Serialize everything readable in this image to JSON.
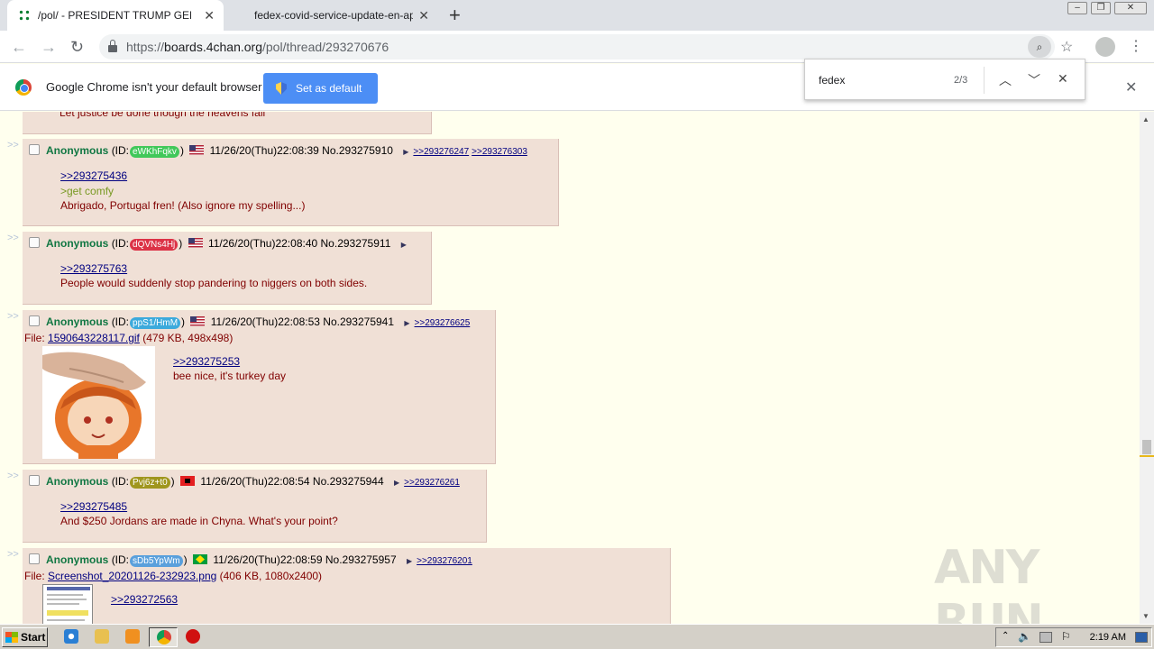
{
  "browser": {
    "tabs": [
      {
        "title": "/pol/ - PRESIDENT TRUMP GENERAL",
        "active": true
      },
      {
        "title": "fedex-covid-service-update-en-apac",
        "active": false
      }
    ],
    "url_scheme": "https://",
    "url_host": "boards.4chan.org",
    "url_path": "/pol/thread/293270676"
  },
  "infobar": {
    "message": "Google Chrome isn't your default browser",
    "button_label": "Set as default"
  },
  "find": {
    "query": "fedex",
    "count": "2/3"
  },
  "partial_post": {
    "text": "Let justice be done though the heavens fall"
  },
  "posts": [
    {
      "name": "Anonymous",
      "id_prefix": "(ID:",
      "id": "eWKhFqkv",
      "id_color": "#41c85a",
      "id_suffix": ")",
      "flag": "us",
      "datetime": "11/26/20(Thu)22:08:39",
      "number": "No.293275910",
      "backlinks": [
        ">>293276247",
        ">>293276303"
      ],
      "quote": ">>293275436",
      "greentext": ">get comfy",
      "text": "Abrigado, Portugal fren! (Also ignore my spelling...)"
    },
    {
      "name": "Anonymous",
      "id_prefix": "(ID:",
      "id": "dQVNs4Hj",
      "id_color": "#dc3246",
      "id_suffix": ")",
      "flag": "us",
      "datetime": "11/26/20(Thu)22:08:40",
      "number": "No.293275911",
      "backlinks": [],
      "quote": ">>293275763",
      "text": "People would suddenly stop pandering to niggers on both sides."
    },
    {
      "name": "Anonymous",
      "id_prefix": "(ID:",
      "id": "ppS1/HmM",
      "id_color": "#3caadc",
      "id_suffix": ")",
      "flag": "us",
      "datetime": "11/26/20(Thu)22:08:53",
      "number": "No.293275941",
      "backlinks": [
        ">>293276625"
      ],
      "file_label": "File:",
      "file_name": "1590643228117.gif",
      "file_info": "(479 KB, 498x498)",
      "quote": ">>293275253",
      "text": "bee nice, it's turkey day"
    },
    {
      "name": "Anonymous",
      "id_prefix": "(ID:",
      "id": "Pvj6z+t0",
      "id_color": "#a0961e",
      "id_suffix": ")",
      "flag": "al",
      "datetime": "11/26/20(Thu)22:08:54",
      "number": "No.293275944",
      "backlinks": [
        ">>293276261"
      ],
      "quote": ">>293275485",
      "text": "And $250 Jordans are made in Chyna. What's your point?"
    },
    {
      "name": "Anonymous",
      "id_prefix": "(ID:",
      "id": "sDb5YpWm",
      "id_color": "#5aa0dc",
      "id_suffix": ")",
      "flag": "br",
      "datetime": "11/26/20(Thu)22:08:59",
      "number": "No.293275957",
      "backlinks": [
        ">>293276201"
      ],
      "file_label": "File:",
      "file_name": "Screenshot_20201126-232923.png",
      "file_info": "(406 KB, 1080x2400)",
      "quote": ">>293272563"
    }
  ],
  "arrow": ">>",
  "taskbar": {
    "start_label": "Start",
    "clock": "2:19 AM"
  },
  "watermark": "ANY RUN"
}
